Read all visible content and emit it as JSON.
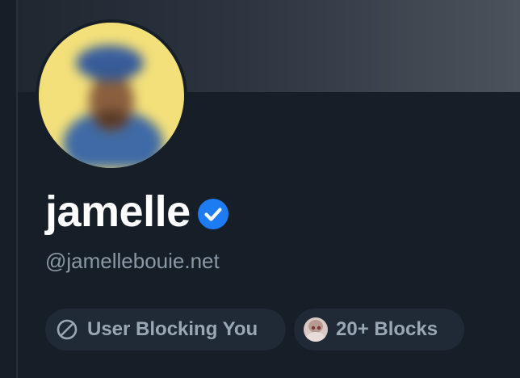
{
  "profile": {
    "display_name": "jamelle",
    "handle": "@jamellebouie.net",
    "verified": true,
    "avatar_icon": "profile-avatar-image",
    "verified_icon": "verified-checkmark-icon"
  },
  "badges": [
    {
      "label": "User Blocking You",
      "icon": "block-icon"
    },
    {
      "label": "20+ Blocks",
      "icon": "blocker-avatar-icon"
    }
  ],
  "colors": {
    "background": "#161e27",
    "banner_start": "#1f2730",
    "banner_end": "#4b525b",
    "name": "#ffffff",
    "handle": "#8b98a6",
    "badge_bg": "#1f2a36",
    "badge_text": "#9aa7b5",
    "verified": "#1d7cf2",
    "avatar_bg": "#f1dc72"
  }
}
